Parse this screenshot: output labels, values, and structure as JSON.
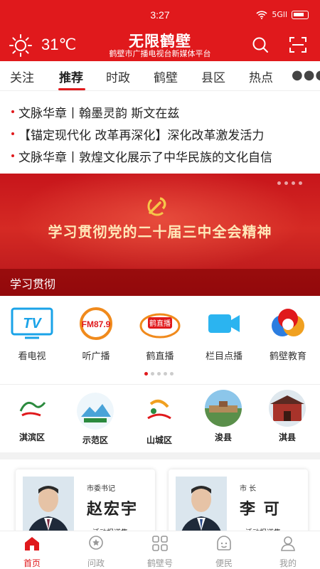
{
  "status": {
    "time": "3:27",
    "signal_label": "5Gll"
  },
  "header": {
    "weather_icon": "sun-icon",
    "temperature": "31℃",
    "title": "无限鹤壁",
    "subtitle": "鹤壁市广播电视台新媒体平台",
    "accent_color": "#e0191c"
  },
  "tabs": [
    {
      "label": "关注"
    },
    {
      "label": "推荐",
      "active": true
    },
    {
      "label": "时政"
    },
    {
      "label": "鹤壁"
    },
    {
      "label": "县区"
    },
    {
      "label": "热点"
    }
  ],
  "headlines": [
    "文脉华章丨翰墨灵韵 斯文在兹",
    "【锚定现代化 改革再深化】深化改革激发活力",
    "文脉华章丨敦煌文化展示了中华民族的文化自信"
  ],
  "banner": {
    "text": "学习贯彻党的二十届三中全会精神",
    "caption": "学习贯彻"
  },
  "shortcuts": [
    {
      "label": "看电视",
      "icon": "tv-icon",
      "icon_text": "TV"
    },
    {
      "label": "听广播",
      "icon": "radio-icon",
      "icon_text": "FM87.9"
    },
    {
      "label": "鹤直播",
      "icon": "live-icon",
      "icon_text": "鹤直播"
    },
    {
      "label": "栏目点播",
      "icon": "video-icon"
    },
    {
      "label": "鹤壁教育",
      "icon": "education-icon"
    }
  ],
  "districts": [
    {
      "label": "淇滨区"
    },
    {
      "label": "示范区"
    },
    {
      "label": "山城区"
    },
    {
      "label": "浚县"
    },
    {
      "label": "淇县"
    }
  ],
  "leaders": [
    {
      "role": "市委书记",
      "name": "赵宏宇",
      "sub": "活动报道集"
    },
    {
      "role": "市 长",
      "name": "李  可",
      "sub": "活动报道集"
    }
  ],
  "bottom_nav": [
    {
      "label": "首页",
      "icon": "home-icon",
      "active": true
    },
    {
      "label": "问政",
      "icon": "question-icon"
    },
    {
      "label": "鹤壁号",
      "icon": "grid-icon"
    },
    {
      "label": "便民",
      "icon": "smile-icon"
    },
    {
      "label": "我的",
      "icon": "user-icon"
    }
  ]
}
